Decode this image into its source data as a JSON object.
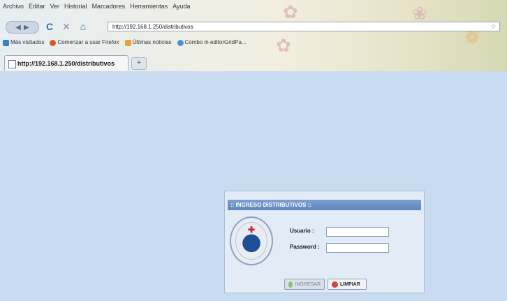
{
  "browser": {
    "menu": [
      "Archivo",
      "Editar",
      "Ver",
      "Historial",
      "Marcadores",
      "Herramientas",
      "Ayuda"
    ],
    "address": "http://192.168.1.250/distributivos",
    "bookmarks": [
      "Más visitados",
      "Comenzar a usar Firefox",
      "Últimas noticias",
      "Combo in editorGridPa..."
    ],
    "tab_title": "http://192.168.1.250/distributivos",
    "new_tab": "+"
  },
  "login": {
    "title": ":: INGRESO DISTRIBUTIVOS ::",
    "user_label": "Usuario :",
    "password_label": "Password :",
    "user_value": "",
    "password_value": "",
    "ingresar_label": "INGRESAR",
    "limpiar_label": "LIMPIAR"
  },
  "colors": {
    "page_bg": "#c9dbf0",
    "panel_header": "#6f94c8"
  },
  "icons": [
    "back-icon",
    "forward-icon",
    "reload-icon",
    "stop-icon",
    "home-icon",
    "star-icon"
  ]
}
